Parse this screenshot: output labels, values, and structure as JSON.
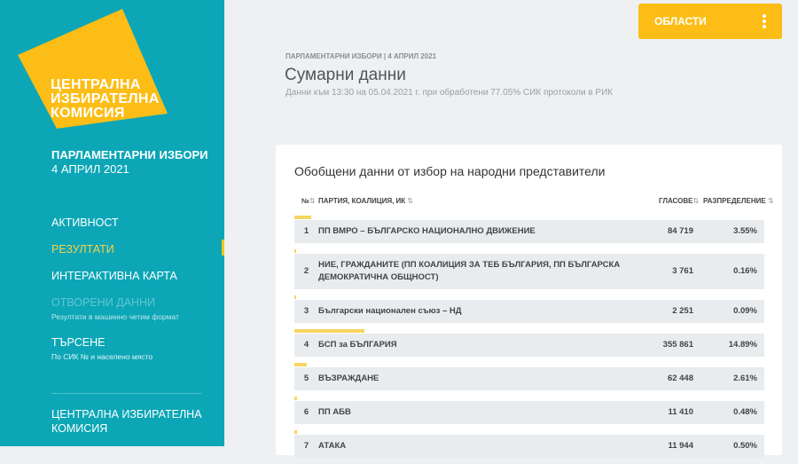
{
  "sidebar": {
    "logo_lines": [
      "ЦЕНТРАЛНА",
      "ИЗБИРАТЕЛНА",
      "КОМИСИЯ"
    ],
    "election_title": "ПАРЛАМЕНТАРНИ ИЗБОРИ",
    "election_date": "4 АПРИЛ 2021",
    "nav": [
      {
        "label": "АКТИВНОСТ"
      },
      {
        "label": "РЕЗУЛТАТИ",
        "active": true
      },
      {
        "label": "ИНТЕРАКТИВНА КАРТА"
      },
      {
        "label": "ОТВОРЕНИ ДАННИ",
        "sub": "Резултати в машинно четим формат"
      },
      {
        "label": "ТЪРСЕНЕ",
        "sub": "По СИК № и населено място"
      }
    ],
    "footer_lines": [
      "ЦЕНТРАЛНА ИЗБИРАТЕЛНА",
      "КОМИСИЯ"
    ]
  },
  "header": {
    "regions_button": "ОБЛАСТИ"
  },
  "main": {
    "breadcrumb": "ПАРЛАМЕНТАРНИ ИЗБОРИ | 4 АПРИЛ 2021",
    "title": "Сумарни данни",
    "subtitle": "Данни към 13:30 на 05.04.2021 г. при обработени 77.05% СИК протоколи в РИК",
    "card_title": "Обобщени данни от избор на народни представители",
    "columns": {
      "no": "№",
      "party": "ПАРТИЯ, КОАЛИЦИЯ, ИК",
      "votes": "ГЛАСОВЕ",
      "distribution": "РАЗПРЕДЕЛЕНИЕ",
      "sort_icon": "⇅"
    },
    "rows": [
      {
        "no": "1",
        "party": "ПП ВМРО – БЪЛГАРСКО НАЦИОНАЛНО ДВИЖЕНИЕ",
        "votes": "84 719",
        "pct": "3.55%",
        "share": 3.55
      },
      {
        "no": "2",
        "party": "НИЕ, ГРАЖДАНИТЕ (ПП КОАЛИЦИЯ ЗА ТЕБ БЪЛГАРИЯ, ПП БЪЛГАРСКА ДЕМОКРАТИЧНА ОБЩНОСТ)",
        "votes": "3 761",
        "pct": "0.16%",
        "share": 0.16
      },
      {
        "no": "3",
        "party": "Български национален съюз – НД",
        "votes": "2 251",
        "pct": "0.09%",
        "share": 0.09
      },
      {
        "no": "4",
        "party": "БСП за БЪЛГАРИЯ",
        "votes": "355 861",
        "pct": "14.89%",
        "share": 14.89
      },
      {
        "no": "5",
        "party": "ВЪЗРАЖДАНЕ",
        "votes": "62 448",
        "pct": "2.61%",
        "share": 2.61
      },
      {
        "no": "6",
        "party": "ПП АБВ",
        "votes": "11 410",
        "pct": "0.48%",
        "share": 0.48
      },
      {
        "no": "7",
        "party": "АТАКА",
        "votes": "11 944",
        "pct": "0.50%",
        "share": 0.5
      }
    ]
  }
}
